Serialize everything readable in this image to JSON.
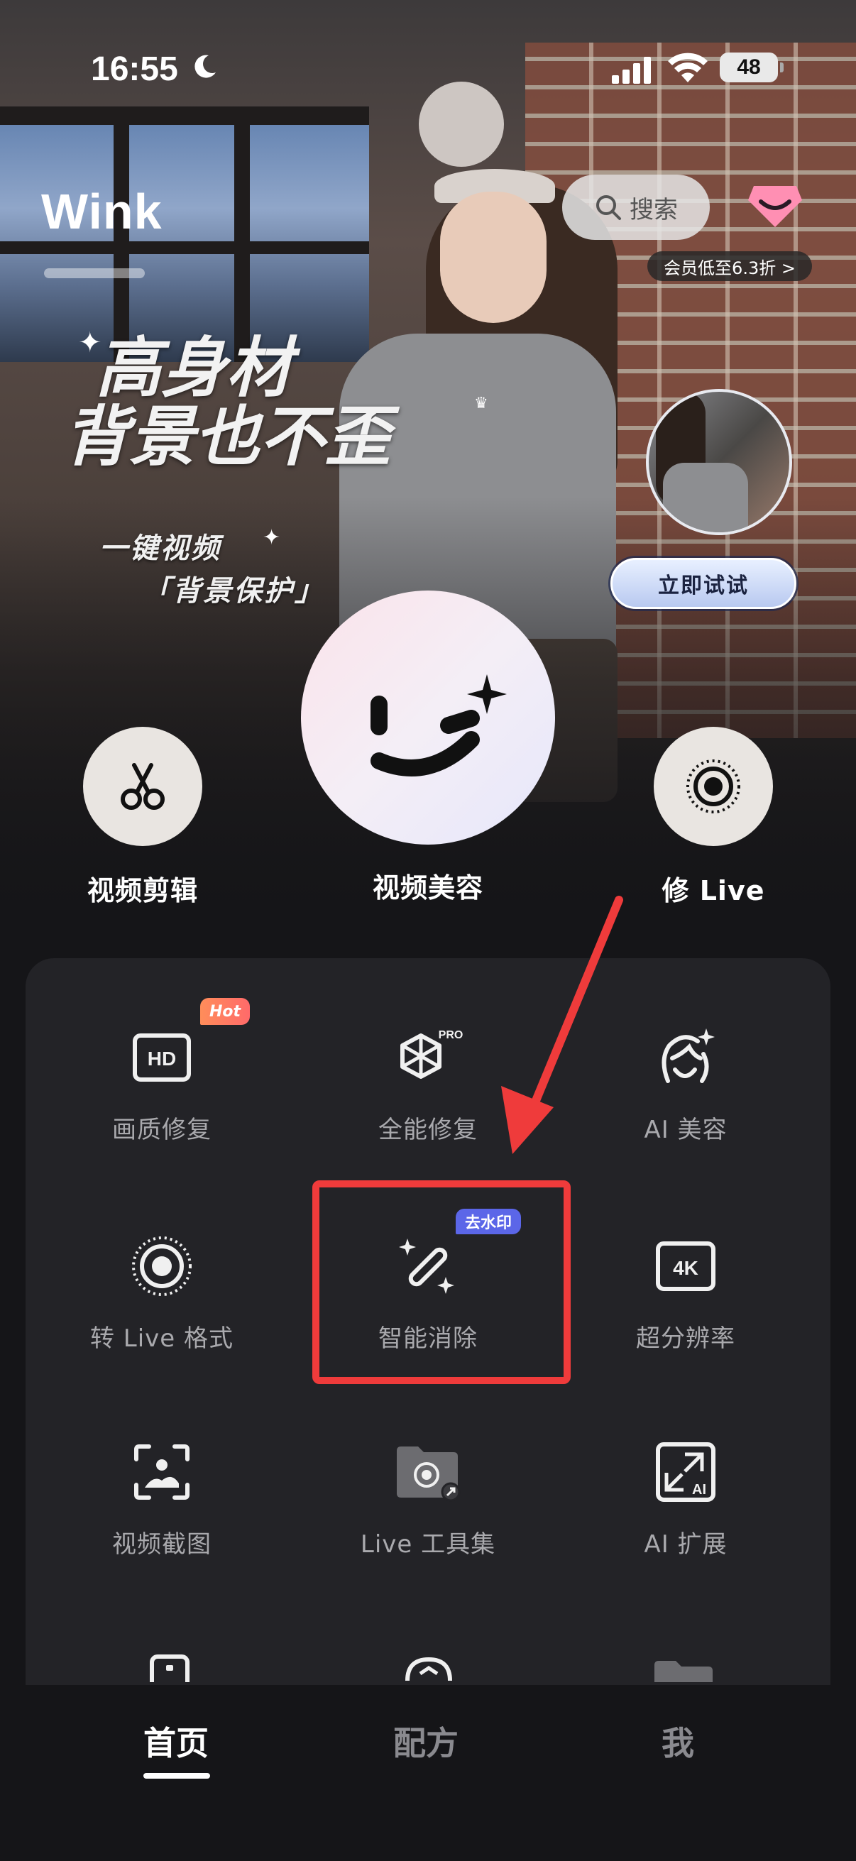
{
  "status_bar": {
    "time": "16:55",
    "battery": "48"
  },
  "header": {
    "logo": "Wink",
    "search_label": "搜索",
    "vip_banner": "会员低至6.3折 >"
  },
  "hero": {
    "title_line1": "高身材",
    "title_line2": "背景也不歪",
    "subtitle": "一键视频",
    "tag": "「背景保护」",
    "try_button": "立即试试"
  },
  "main_actions": [
    {
      "label": "视频剪辑",
      "icon": "scissors-icon"
    },
    {
      "label": "视频美容",
      "icon": "smile-logo-icon"
    },
    {
      "label": "修 Live",
      "icon": "live-ring-icon"
    }
  ],
  "tools": [
    {
      "label": "画质修复",
      "icon": "hd-icon",
      "badge": "Hot"
    },
    {
      "label": "全能修复",
      "icon": "pro-cube-icon",
      "badge": "PRO"
    },
    {
      "label": "AI 美容",
      "icon": "ai-face-icon"
    },
    {
      "label": "转 Live 格式",
      "icon": "live-format-icon"
    },
    {
      "label": "智能消除",
      "icon": "magic-wand-icon",
      "badge": "去水印"
    },
    {
      "label": "超分辨率",
      "icon": "4k-icon"
    },
    {
      "label": "视频截图",
      "icon": "screenshot-icon"
    },
    {
      "label": "Live 工具集",
      "icon": "live-folder-icon"
    },
    {
      "label": "AI 扩展",
      "icon": "ai-expand-icon"
    }
  ],
  "bottom_nav": [
    {
      "label": "首页",
      "active": true
    },
    {
      "label": "配方",
      "active": false
    },
    {
      "label": "我",
      "active": false
    }
  ],
  "colors": {
    "highlight": "#ef3b3b",
    "panel": "#232327",
    "background": "#151518",
    "badge_hot": "#ff7a5e",
    "badge_wm": "#5b66e8"
  }
}
